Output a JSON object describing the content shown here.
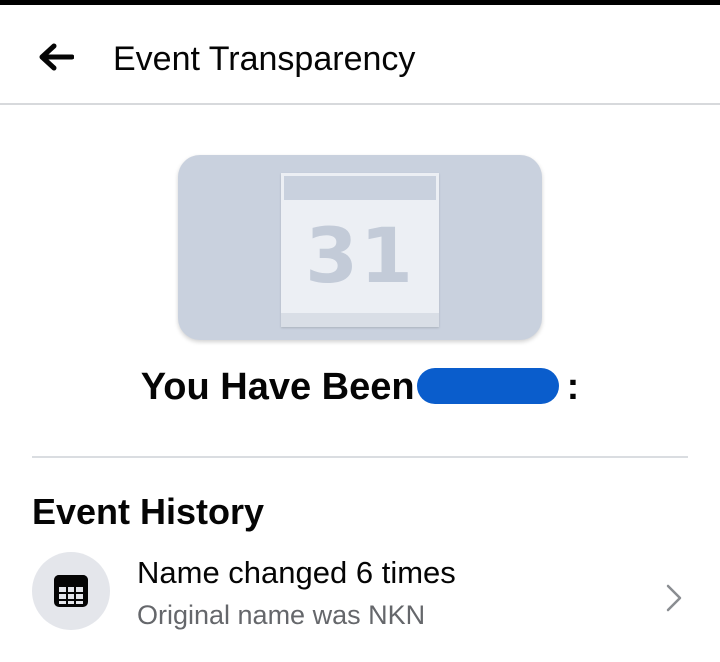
{
  "header": {
    "back_icon": "arrow-left-icon",
    "title": "Event Transparency"
  },
  "event": {
    "cover_icon": "calendar-icon",
    "cover_day": "31",
    "name_prefix": "You Have Been",
    "name_suffix": ":",
    "redaction_color": "#0a5dcc"
  },
  "history": {
    "section_title": "Event History",
    "items": [
      {
        "icon": "calendar-grid-icon",
        "title": "Name changed 6 times",
        "subtitle": "Original name was NKN",
        "chevron": "chevron-right-icon"
      }
    ]
  },
  "colors": {
    "text_primary": "#050505",
    "text_secondary": "#65676b",
    "divider": "#dadde1",
    "cover_background": "#c9d1de",
    "icon_circle": "#e4e6eb"
  }
}
